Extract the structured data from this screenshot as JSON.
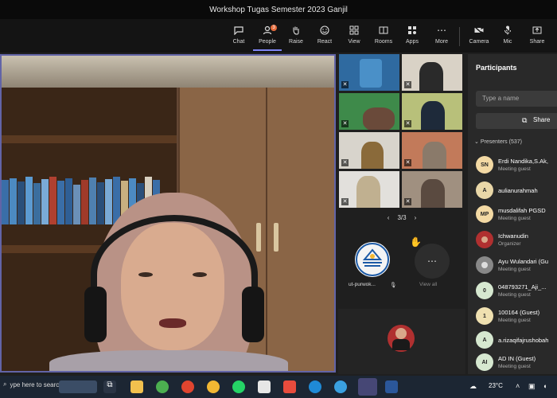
{
  "window": {
    "title": "Workshop Tugas Semester 2023 Ganjil"
  },
  "toolbar": {
    "items": [
      {
        "label": "Chat",
        "icon": "chat-icon"
      },
      {
        "label": "People",
        "icon": "people-icon",
        "badge": "3"
      },
      {
        "label": "Raise",
        "icon": "raise-hand-icon"
      },
      {
        "label": "React",
        "icon": "react-icon"
      },
      {
        "label": "View",
        "icon": "view-icon"
      },
      {
        "label": "Rooms",
        "icon": "rooms-icon"
      },
      {
        "label": "Apps",
        "icon": "apps-icon"
      },
      {
        "label": "More",
        "icon": "more-icon"
      },
      {
        "label": "Camera",
        "icon": "camera-icon"
      },
      {
        "label": "Mic",
        "icon": "mic-icon"
      },
      {
        "label": "Share",
        "icon": "share-icon"
      }
    ]
  },
  "gallery": {
    "pager": "3/3",
    "tiles": [
      {
        "name": "ut-purwoke...",
        "label": "ut-purwok..."
      },
      {
        "name": "View all",
        "label": "View all"
      }
    ]
  },
  "panel": {
    "title": "Participants",
    "search_placeholder": "Type a name",
    "share_label": "Share",
    "presenters_label": "Presenters (537)",
    "participants": [
      {
        "initials": "SN",
        "name": "Erdi Nandika,S.Ak,",
        "role": "Meeting guest",
        "color": "#f3d9a4"
      },
      {
        "initials": "A",
        "name": "aulianurahmah",
        "role": "",
        "color": "#e9d7a8"
      },
      {
        "initials": "MP",
        "name": "musdalifah PGSD",
        "role": "Meeting guest",
        "color": "#f3d9a4"
      },
      {
        "initials": "",
        "name": "Ichwanudin",
        "role": "Organizer",
        "color": "#b03030"
      },
      {
        "initials": "",
        "name": "Ayu Wulandari (Gu",
        "role": "Meeting guest",
        "color": "#888888"
      },
      {
        "initials": "0",
        "name": "048793271_Aji_...",
        "role": "Meeting guest",
        "color": "#d6e8d0"
      },
      {
        "initials": "1",
        "name": "100164 (Guest)",
        "role": "Meeting guest",
        "color": "#efe0b0"
      },
      {
        "initials": "A",
        "name": "a.rizaqifajrushobah",
        "role": "",
        "color": "#d6e8d0"
      },
      {
        "initials": "AI",
        "name": "AD IN (Guest)",
        "role": "Meeting guest",
        "color": "#d6e8d0"
      }
    ]
  },
  "taskbar": {
    "search_label": "ype here to search",
    "temperature": "23°C"
  }
}
